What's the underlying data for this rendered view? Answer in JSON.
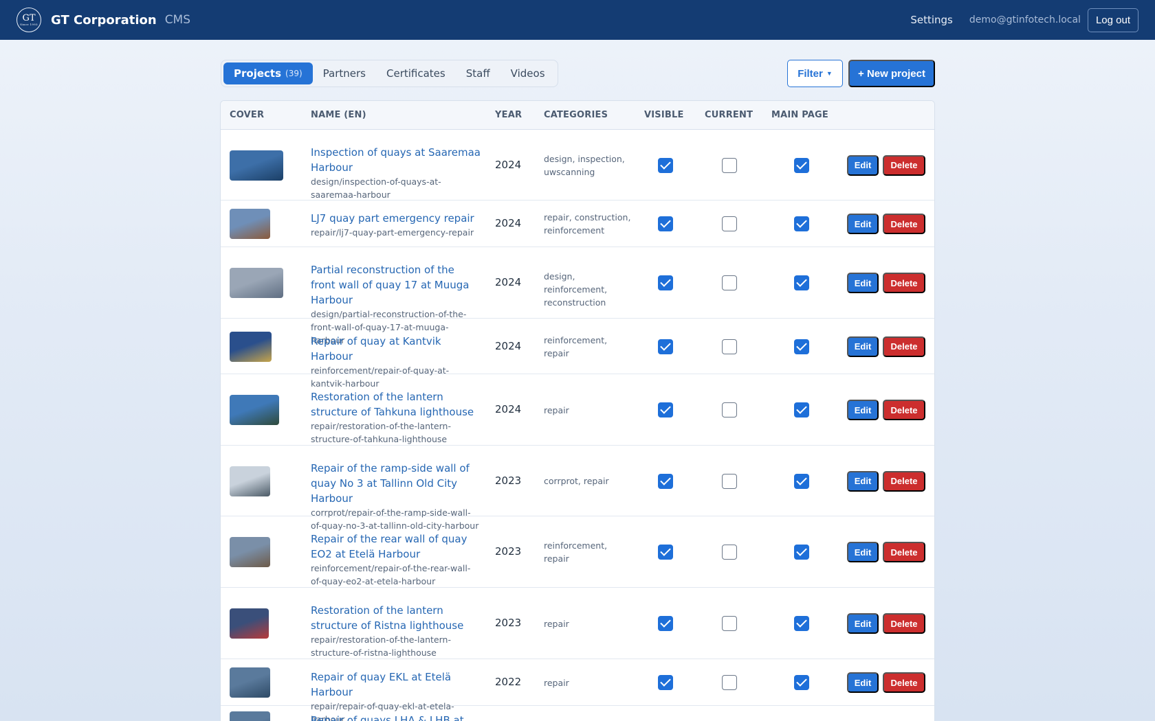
{
  "header": {
    "logo_monogram": "GT",
    "logo_since": "Since 1993",
    "brand": "GT Corporation",
    "brand_sub": "CMS",
    "settings": "Settings",
    "user_email": "demo@gtinfotech.local",
    "logout": "Log out"
  },
  "tabs": [
    {
      "label": "Projects",
      "count": "(39)",
      "active": true
    },
    {
      "label": "Partners"
    },
    {
      "label": "Certificates"
    },
    {
      "label": "Staff"
    },
    {
      "label": "Videos"
    }
  ],
  "toolbar": {
    "filter": "Filter",
    "new_project": "+ New project"
  },
  "table": {
    "columns": {
      "cover": "COVER",
      "name": "NAME (EN)",
      "year": "YEAR",
      "categories": "CATEGORIES",
      "visible": "VISIBLE",
      "current": "CURRENT",
      "main_page": "MAIN PAGE"
    },
    "edit_label": "Edit",
    "delete_label": "Delete",
    "rows": [
      {
        "name": "Inspection of quays at Saaremaa Harbour",
        "slug": "design/inspection-of-quays-at-saaremaa-harbour",
        "year": "2024",
        "categories": "design, inspection, uwscanning",
        "visible": true,
        "current": false,
        "main_page": true,
        "cover_colors": [
          "#3d6fa8",
          "#1b3f66"
        ]
      },
      {
        "name": "LJ7 quay part emergency repair",
        "slug": "repair/lj7-quay-part-emergency-repair",
        "year": "2024",
        "categories": "repair, construction, reinforcement",
        "visible": true,
        "current": false,
        "main_page": true,
        "cover_colors": [
          "#6f8fb8",
          "#8a5a3a"
        ]
      },
      {
        "name": "Partial reconstruction of the front wall of quay 17 at Muuga Harbour",
        "slug": "design/partial-reconstruction-of-the-front-wall-of-quay-17-at-muuga-harbour",
        "year": "2024",
        "categories": "design, reinforcement, reconstruction",
        "visible": true,
        "current": false,
        "main_page": true,
        "cover_colors": [
          "#9aa6b6",
          "#5f6e82"
        ]
      },
      {
        "name": "Repair of quay at Kantvik Harbour",
        "slug": "reinforcement/repair-of-quay-at-kantvik-harbour",
        "year": "2024",
        "categories": "reinforcement, repair",
        "visible": true,
        "current": false,
        "main_page": true,
        "cover_colors": [
          "#2a4f8c",
          "#c7a54a"
        ]
      },
      {
        "name": "Restoration of the lantern structure of Tahkuna lighthouse",
        "slug": "repair/restoration-of-the-lantern-structure-of-tahkuna-lighthouse",
        "year": "2024",
        "categories": "repair",
        "visible": true,
        "current": false,
        "main_page": true,
        "cover_colors": [
          "#3f79b8",
          "#2f4a3a"
        ]
      },
      {
        "name": "Repair of the ramp-side wall of quay No 3 at Tallinn Old City Harbour",
        "slug": "corrprot/repair-of-the-ramp-side-wall-of-quay-no-3-at-tallinn-old-city-harbour",
        "year": "2023",
        "categories": "corrprot, repair",
        "visible": true,
        "current": false,
        "main_page": true,
        "cover_colors": [
          "#c9d2dc",
          "#4b5a66"
        ]
      },
      {
        "name": "Repair of the rear wall of quay EO2 at Etelä Harbour",
        "slug": "reinforcement/repair-of-the-rear-wall-of-quay-eo2-at-etela-harbour",
        "year": "2023",
        "categories": "reinforcement, repair",
        "visible": true,
        "current": false,
        "main_page": true,
        "cover_colors": [
          "#7a8fa8",
          "#6d5a48"
        ]
      },
      {
        "name": "Restoration of the lantern structure of Ristna lighthouse",
        "slug": "repair/restoration-of-the-lantern-structure-of-ristna-lighthouse",
        "year": "2023",
        "categories": "repair",
        "visible": true,
        "current": false,
        "main_page": true,
        "cover_colors": [
          "#3a4f7a",
          "#b83a3a"
        ]
      },
      {
        "name": "Repair of quay EKL at Etelä Harbour",
        "slug": "repair/repair-of-quay-ekl-at-etela-harbour",
        "year": "2022",
        "categories": "repair",
        "visible": true,
        "current": false,
        "main_page": true,
        "cover_colors": [
          "#5a7a9c",
          "#2e4a66"
        ]
      },
      {
        "name": "Repair of quays LHA & LHB at Länsi",
        "slug": "",
        "year": "",
        "categories": "",
        "visible": true,
        "current": false,
        "main_page": true,
        "cover_colors": [
          "#5a7a9c",
          "#2e4a66"
        ]
      }
    ]
  }
}
